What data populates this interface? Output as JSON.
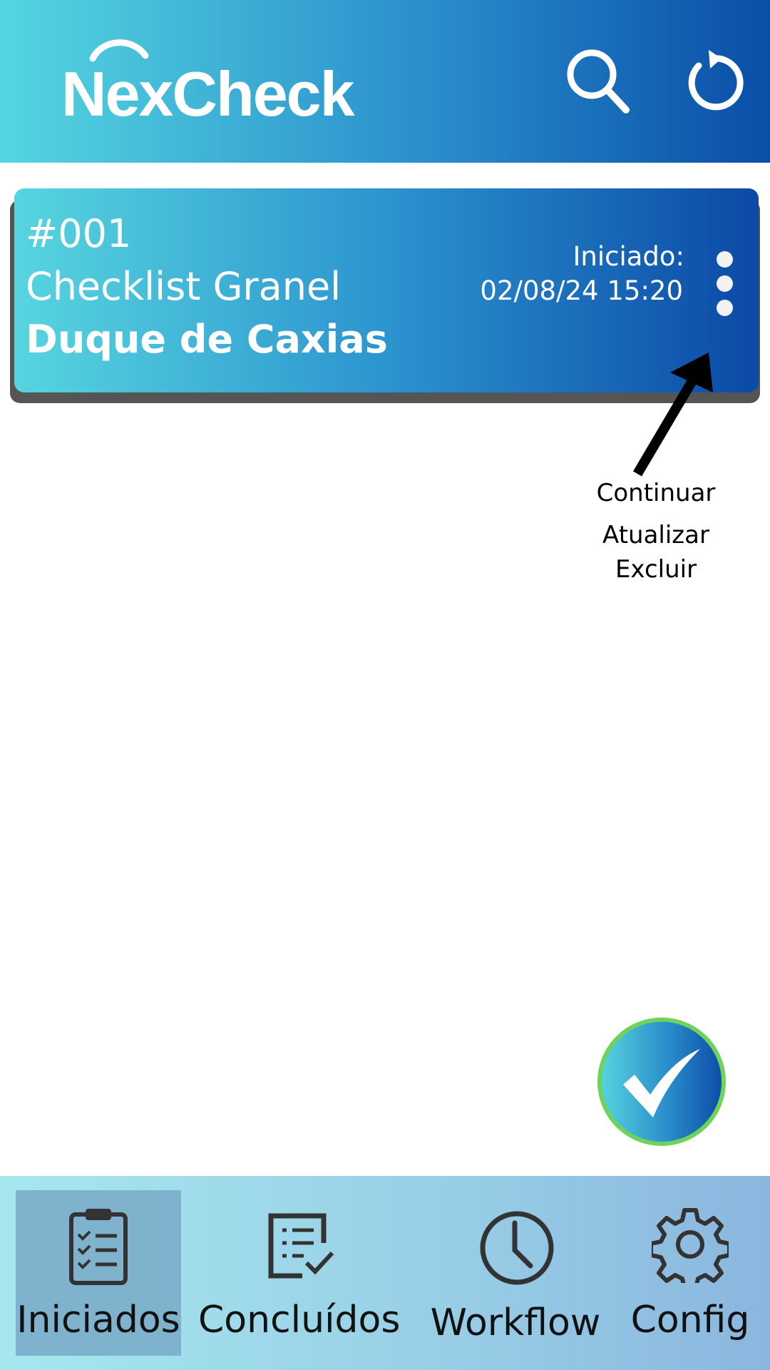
{
  "header": {
    "brand": "NexCheck",
    "search_icon": "search-icon",
    "refresh_icon": "refresh-icon",
    "gradient": [
      "#55d6e0",
      "#0a4ea8"
    ]
  },
  "checklist": {
    "number": "#001",
    "name": "Checklist Granel",
    "location": "Duque de Caxias",
    "status_label": "Iniciado:",
    "status_date": "02/08/24 15:20",
    "menu_icon": "more-vertical-icon"
  },
  "menu_hint": {
    "items": [
      "Continuar",
      "Atualizar",
      "Excluir"
    ]
  },
  "fab": {
    "icon": "checkmark-icon",
    "border_color": "#6fd25a"
  },
  "bottom_nav": {
    "items": [
      {
        "label": "Iniciados",
        "icon": "clipboard-checklist-icon",
        "active": true
      },
      {
        "label": "Concluídos",
        "icon": "document-check-icon",
        "active": false
      },
      {
        "label": "Workflow",
        "icon": "clock-icon",
        "active": false
      },
      {
        "label": "Config",
        "icon": "gear-icon",
        "active": false
      }
    ]
  }
}
